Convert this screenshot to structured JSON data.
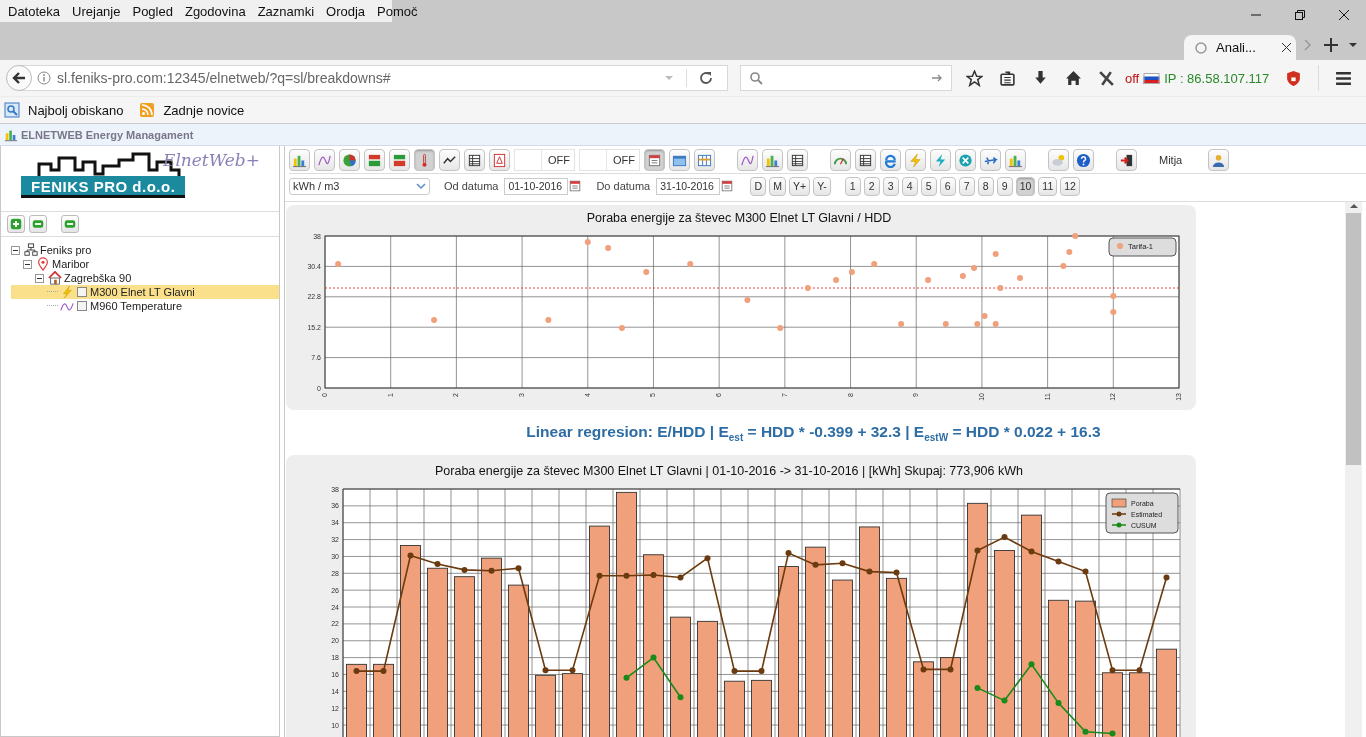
{
  "menu": [
    "Datoteka",
    "Urejanje",
    "Pogled",
    "Zgodovina",
    "Zaznamki",
    "Orodja",
    "Pomoč"
  ],
  "tab": {
    "title": "Anali..."
  },
  "address_bar": {
    "url": "sl.feniks-pro.com:12345/elnetweb/?q=sl/breakdowns#"
  },
  "extension": {
    "status": "off",
    "ip": "IP : 86.58.107.117"
  },
  "bookmarks": [
    "Najbolj obiskano",
    "Zadnje novice"
  ],
  "app_title": "ELNETWEB Energy Managament",
  "logo": {
    "company": "FENIKS PRO d.o.o.",
    "product": "ElnetWeb+"
  },
  "tree": [
    {
      "label": "Feniks pro",
      "kind": "company",
      "expanded": true,
      "children": [
        {
          "label": "Maribor",
          "kind": "location",
          "expanded": true,
          "children": [
            {
              "label": "Zagrebška 90",
              "kind": "building",
              "expanded": true,
              "children": [
                {
                  "label": "M300 Elnet LT Glavni",
                  "kind": "meter",
                  "checked": false,
                  "selected": true
                },
                {
                  "label": "M960 Temperature",
                  "kind": "sensor",
                  "checked": false,
                  "selected": false
                }
              ]
            }
          ]
        }
      ]
    }
  ],
  "toolbar": [
    {
      "items": [
        {
          "kind": "button",
          "pressed": false
        },
        {
          "kind": "button",
          "pressed": false
        },
        {
          "kind": "button",
          "pressed": false
        },
        {
          "kind": "button",
          "pressed": false
        },
        {
          "kind": "button",
          "pressed": false
        },
        {
          "kind": "button",
          "pressed": true
        },
        {
          "kind": "button",
          "pressed": false
        },
        {
          "kind": "button",
          "pressed": false
        },
        {
          "kind": "button",
          "pressed": false
        },
        {
          "kind": "toggle",
          "label": "OFF",
          "on": false
        },
        {
          "kind": "toggle",
          "label": "OFF",
          "on": false
        },
        {
          "kind": "button",
          "pressed": true
        },
        {
          "kind": "button",
          "pressed": false
        },
        {
          "kind": "button",
          "pressed": false
        }
      ]
    },
    {
      "items": [
        {
          "kind": "button",
          "pressed": false
        },
        {
          "kind": "button",
          "pressed": false
        },
        {
          "kind": "button",
          "pressed": false
        }
      ]
    },
    {
      "items": [
        {
          "kind": "button",
          "pressed": false
        },
        {
          "kind": "button",
          "pressed": false
        },
        {
          "kind": "button",
          "pressed": false
        },
        {
          "kind": "button",
          "pressed": false
        },
        {
          "kind": "button",
          "pressed": false
        },
        {
          "kind": "button",
          "pressed": false
        },
        {
          "kind": "button",
          "pressed": false
        },
        {
          "kind": "button",
          "pressed": false
        }
      ]
    },
    {
      "items": [
        {
          "kind": "button",
          "pressed": false
        },
        {
          "kind": "button",
          "pressed": false
        }
      ]
    },
    {
      "items": [
        {
          "kind": "button",
          "pressed": false
        },
        {
          "kind": "user",
          "label": "Mitja"
        },
        {
          "kind": "button",
          "pressed": false
        }
      ]
    }
  ],
  "unit_select": {
    "value": "kWh / m3"
  },
  "date_from": {
    "label": "Od datuma",
    "value": "01-10-2016"
  },
  "date_to": {
    "label": "Do datuma",
    "value": "31-10-2016"
  },
  "period_buttons": [
    "D",
    "M",
    "Y+",
    "Y-"
  ],
  "months": [
    {
      "label": "1",
      "selected": false
    },
    {
      "label": "2",
      "selected": false
    },
    {
      "label": "3",
      "selected": false
    },
    {
      "label": "4",
      "selected": false
    },
    {
      "label": "5",
      "selected": false
    },
    {
      "label": "6",
      "selected": false
    },
    {
      "label": "7",
      "selected": false
    },
    {
      "label": "8",
      "selected": false
    },
    {
      "label": "9",
      "selected": false
    },
    {
      "label": "10",
      "selected": true
    },
    {
      "label": "11",
      "selected": false
    },
    {
      "label": "12",
      "selected": false
    }
  ],
  "scatter_chart": {
    "chart_data": {
      "type": "scatter",
      "title": "Poraba energije za števec M300 Elnet LT Glavni / HDD",
      "x": [
        0.2,
        1.66,
        3.4,
        4.0,
        4.31,
        4.52,
        4.89,
        5.56,
        6.43,
        6.93,
        7.35,
        7.78,
        8.02,
        8.36,
        8.77,
        9.18,
        9.45,
        9.71,
        9.88,
        9.93,
        10.04,
        10.21,
        10.21,
        10.28,
        10.58,
        11.24,
        11.33,
        11.42,
        12.0,
        12.0
      ],
      "series": [
        {
          "name": "Tarifa-1",
          "color": "#f0a07a",
          "values": [
            31,
            17,
            17,
            36.5,
            35,
            15,
            29,
            31,
            22,
            15,
            25,
            27,
            29,
            31,
            16,
            27,
            16,
            28,
            30,
            16,
            18,
            33.5,
            16,
            25,
            27.5,
            30.5,
            34,
            38,
            23,
            19
          ]
        }
      ],
      "xlim": [
        0,
        13
      ],
      "ylim": [
        0,
        38
      ],
      "xticks": [
        0,
        1,
        2,
        3,
        4,
        5,
        6,
        7,
        8,
        9,
        10,
        11,
        12,
        13
      ],
      "yticks": [
        0,
        7.6,
        15.2,
        22.8,
        30.4,
        38
      ],
      "grid": true,
      "ref_lines": [
        {
          "axis": "y",
          "value": 25,
          "color": "#e03030"
        }
      ],
      "legend": true
    }
  },
  "regression": "Linear regresion: E/HDD | E$_{est}$ = HDD * -0.399 + 32.3 | E$_{estW}$ = HDD * 0.022 + 16.3",
  "consumption_chart": {
    "chart_data": {
      "type": "bar",
      "title": "Poraba energije za števec M300 Elnet LT Glavni | 01-10-2016 -> 31-10-2016 | [kWh] Skupaj: 773,906 kWh",
      "series": [
        {
          "name": "Poraba",
          "type": "bar",
          "color": "#f0a07a",
          "values": [
            17.2,
            17.2,
            31.3,
            28.6,
            27.6,
            29.8,
            26.6,
            15.9,
            16.1,
            33.6,
            37.6,
            30.2,
            22.8,
            22.3,
            15.2,
            15.3,
            28.8,
            31.1,
            27.2,
            33.5,
            27.4,
            17.5,
            18.0,
            36.3,
            30.7,
            34.9,
            24.8,
            24.7,
            16.2,
            16.2,
            19.0
          ]
        },
        {
          "name": "Estimated",
          "type": "line",
          "marker": "o",
          "color": "#6b3a0f",
          "values": [
            16.4,
            16.4,
            30.1,
            29.1,
            28.4,
            28.3,
            28.6,
            16.5,
            16.5,
            27.7,
            27.7,
            27.8,
            27.5,
            29.8,
            16.4,
            16.4,
            30.4,
            29.0,
            29.2,
            28.2,
            28.1,
            16.6,
            16.6,
            30.7,
            32.3,
            30.6,
            29.4,
            28.2,
            16.5,
            16.5,
            27.5
          ]
        },
        {
          "name": "CUSUM",
          "type": "line",
          "marker": "o",
          "color": "#1a8a1a",
          "values": [
            null,
            null,
            null,
            null,
            null,
            null,
            null,
            null,
            null,
            null,
            15.6,
            18.0,
            13.3,
            null,
            null,
            null,
            null,
            null,
            null,
            null,
            null,
            null,
            null,
            14.4,
            12.9,
            17.2,
            12.6,
            9.2,
            9.0,
            null,
            null
          ]
        }
      ],
      "ylim": [
        8.6,
        38
      ],
      "yticks": [
        10,
        12,
        14,
        16,
        18,
        20,
        22,
        24,
        26,
        28,
        30,
        32,
        34,
        36,
        38
      ],
      "grid": true,
      "legend": true
    }
  }
}
